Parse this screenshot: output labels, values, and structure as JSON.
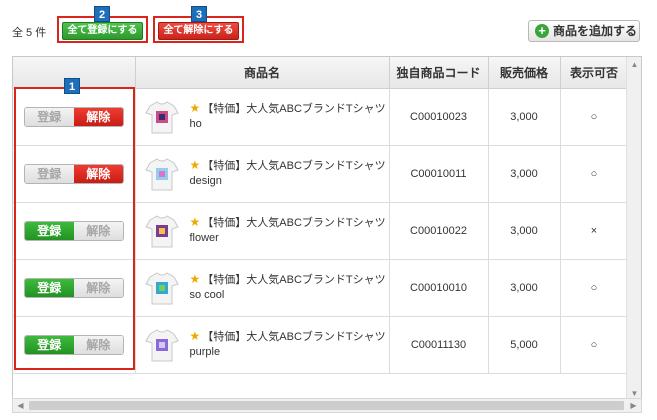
{
  "toolbar": {
    "count_label": "全 5 件",
    "register_all": "全て登録にする",
    "release_all": "全て解除にする",
    "add_product": "商品を追加する"
  },
  "badges": {
    "b1": "1",
    "b2": "2",
    "b3": "3"
  },
  "table": {
    "headers": {
      "name": "商品名",
      "code": "独自商品コード",
      "price": "販売価格",
      "visible": "表示可否"
    },
    "register_label": "登録",
    "release_label": "解除",
    "rows": [
      {
        "name": "【特価】大人気ABCブランドTシャツho",
        "code": "C00010023",
        "price": "3,000",
        "visible": "○",
        "state": "released"
      },
      {
        "name": "【特価】大人気ABCブランドTシャツdesign",
        "code": "C00010011",
        "price": "3,000",
        "visible": "○",
        "state": "released"
      },
      {
        "name": "【特価】大人気ABCブランドTシャツflower",
        "code": "C00010022",
        "price": "3,000",
        "visible": "×",
        "state": "registered"
      },
      {
        "name": "【特価】大人気ABCブランドTシャツso cool",
        "code": "C00010010",
        "price": "3,000",
        "visible": "○",
        "state": "registered"
      },
      {
        "name": "【特価】大人気ABCブランドTシャツpurple",
        "code": "C00011130",
        "price": "5,000",
        "visible": "○",
        "state": "registered"
      }
    ]
  },
  "icons": {
    "star": "star-icon",
    "add": "plus-circle-icon"
  },
  "colors": {
    "register_green": "#2ea62e",
    "release_red": "#d9251c",
    "highlight_red": "#d9251c",
    "badge_blue": "#1e6fb8"
  }
}
